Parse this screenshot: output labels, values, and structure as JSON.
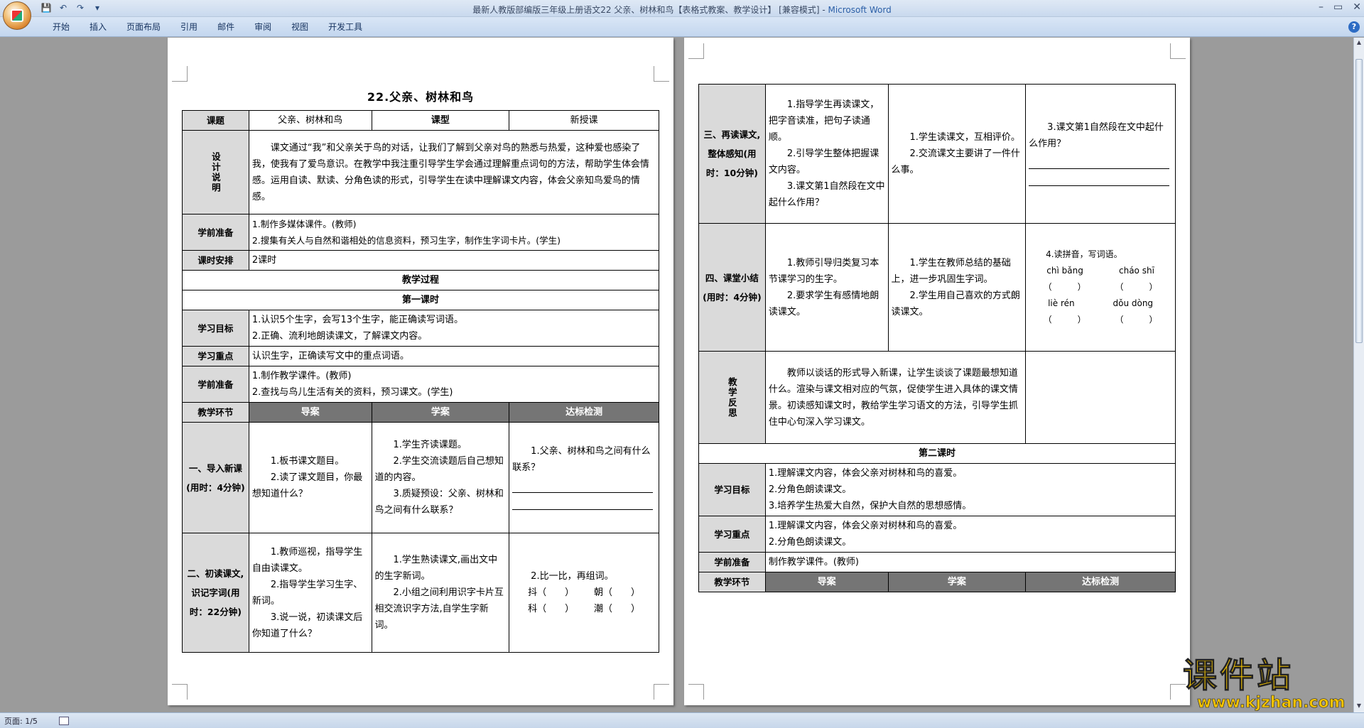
{
  "window": {
    "title": "最新人教版部编版三年级上册语文22 父亲、树林和鸟【表格式教案、教学设计】 [兼容模式] - ",
    "app_name": "Microsoft Word",
    "qat": {
      "save": "💾",
      "undo": "↶",
      "redo": "↷",
      "more": "▾"
    },
    "controls": {
      "minimize": "–",
      "maximize": "▭",
      "close": "✕"
    }
  },
  "ribbon": {
    "tabs": [
      "开始",
      "插入",
      "页面布局",
      "引用",
      "邮件",
      "审阅",
      "视图",
      "开发工具"
    ],
    "help": "?"
  },
  "status": {
    "page": "页面: 1/5"
  },
  "page1": {
    "title": "22.父亲、树林和鸟",
    "row1": {
      "k1": "课题",
      "v1": "父亲、树林和鸟",
      "k2": "课型",
      "v2": "新授课"
    },
    "design": {
      "k": "设计说明",
      "v": "课文通过“我”和父亲关于鸟的对话，让我们了解到父亲对鸟的熟悉与热爱，这种爱也感染了我，使我有了爱鸟意识。在教学中我注重引导学生学会通过理解重点词句的方法，帮助学生体会情感。运用自读、默读、分角色读的形式，引导学生在读中理解课文内容，体会父亲知鸟爱鸟的情感。"
    },
    "prep": {
      "k": "学前准备",
      "v1": "1.制作多媒体课件。(教师)",
      "v2": "2.搜集有关人与自然和谐相处的信息资料，预习生字，制作生字词卡片。(学生)"
    },
    "hours": {
      "k": "课时安排",
      "v": "2课时"
    },
    "process": "教学过程",
    "lesson1": "第一课时",
    "goal": {
      "k": "学习目标",
      "v1": "1.认识5个生字，会写13个生字，能正确读写词语。",
      "v2": "2.正确、流利地朗读课文，了解课文内容。"
    },
    "focus": {
      "k": "学习重点",
      "v": "认识生字，正确读写文中的重点词语。"
    },
    "prep2": {
      "k": "学前准备",
      "v1": "1.制作教学课件。(教师)",
      "v2": "2.查找与鸟儿生活有关的资料，预习课文。(学生)"
    },
    "cols": {
      "k": "教学环节",
      "a": "导案",
      "b": "学案",
      "c": "达标检测"
    },
    "step1": {
      "k": "一、导入新课(用时：4分钟)",
      "a": [
        "1.板书课文题目。",
        "2.读了课文题目，你最想知道什么？"
      ],
      "b": [
        "1.学生齐读课题。",
        "2.学生交流读题后自己想知道的内容。",
        "3.质疑预设：父亲、树林和鸟之间有什么联系？"
      ],
      "c": "1.父亲、树林和鸟之间有什么联系？"
    },
    "step2": {
      "k": "二、初读课文,识记字词(用时：22分钟)",
      "a": [
        "1.教师巡视，指导学生自由读课文。",
        "2.指导学生学习生字、新词。",
        "3.说一说，初读课文后你知道了什么？"
      ],
      "b": [
        "1.学生熟读课文,画出文中的生字新词。",
        "2.小组之间利用识字卡片互相交流识字方法,自学生字新词。"
      ],
      "c": "2.比一比，再组词。",
      "c_rows": [
        [
          "抖（　　）",
          "朝（　　）"
        ],
        [
          "科（　　）",
          "潮（　　）"
        ]
      ]
    }
  },
  "page2": {
    "step3": {
      "k": "三、再读课文,整体感知(用时：10分钟)",
      "a": [
        "1.指导学生再读课文，把字音读准，把句子读通顺。",
        "2.引导学生整体把握课文内容。",
        "3.课文第1自然段在文中起什么作用？"
      ],
      "b": [
        "1.学生读课文，互相评价。",
        "2.交流课文主要讲了一件什么事。"
      ],
      "c": "3.课文第1自然段在文中起什么作用？"
    },
    "step4": {
      "k": "四、课堂小结(用时：4分钟)",
      "a": [
        "1.教师引导归类复习本节课学习的生字。",
        "2.要求学生有感情地朗读课文。"
      ],
      "b": [
        "1.学生在教师总结的基础上，进一步巩固生字词。",
        "2.学生用自己喜欢的方式朗读课文。"
      ],
      "c": "4.读拼音，写词语。",
      "pinyin": [
        [
          "chì bǎng",
          "cháo shī"
        ],
        [
          "liè rén",
          "dǒu dòng"
        ]
      ],
      "blank": "（　　　）"
    },
    "reflect": {
      "k": "教学反思",
      "v": "教师以谈话的形式导入新课，让学生谈谈了课题最想知道什么。渲染与课文相对应的气氛，促使学生进入具体的课文情景。初读感知课文时，教给学生学习语文的方法，引导学生抓住中心句深入学习课文。"
    },
    "lesson2": "第二课时",
    "goal": {
      "k": "学习目标",
      "v1": "1.理解课文内容，体会父亲对树林和鸟的喜爱。",
      "v2": "2.分角色朗读课文。",
      "v3": "3.培养学生热爱大自然，保护大自然的思想感情。"
    },
    "focus": {
      "k": "学习重点",
      "v1": "1.理解课文内容，体会父亲对树林和鸟的喜爱。",
      "v2": "2.分角色朗读课文。"
    },
    "prep": {
      "k": "学前准备",
      "v": "制作教学课件。(教师)"
    },
    "cols": {
      "k": "教学环节",
      "a": "导案",
      "b": "学案",
      "c": "达标检测"
    }
  },
  "watermark": {
    "big": "课件站",
    "url": "www.kjzhan.com"
  }
}
